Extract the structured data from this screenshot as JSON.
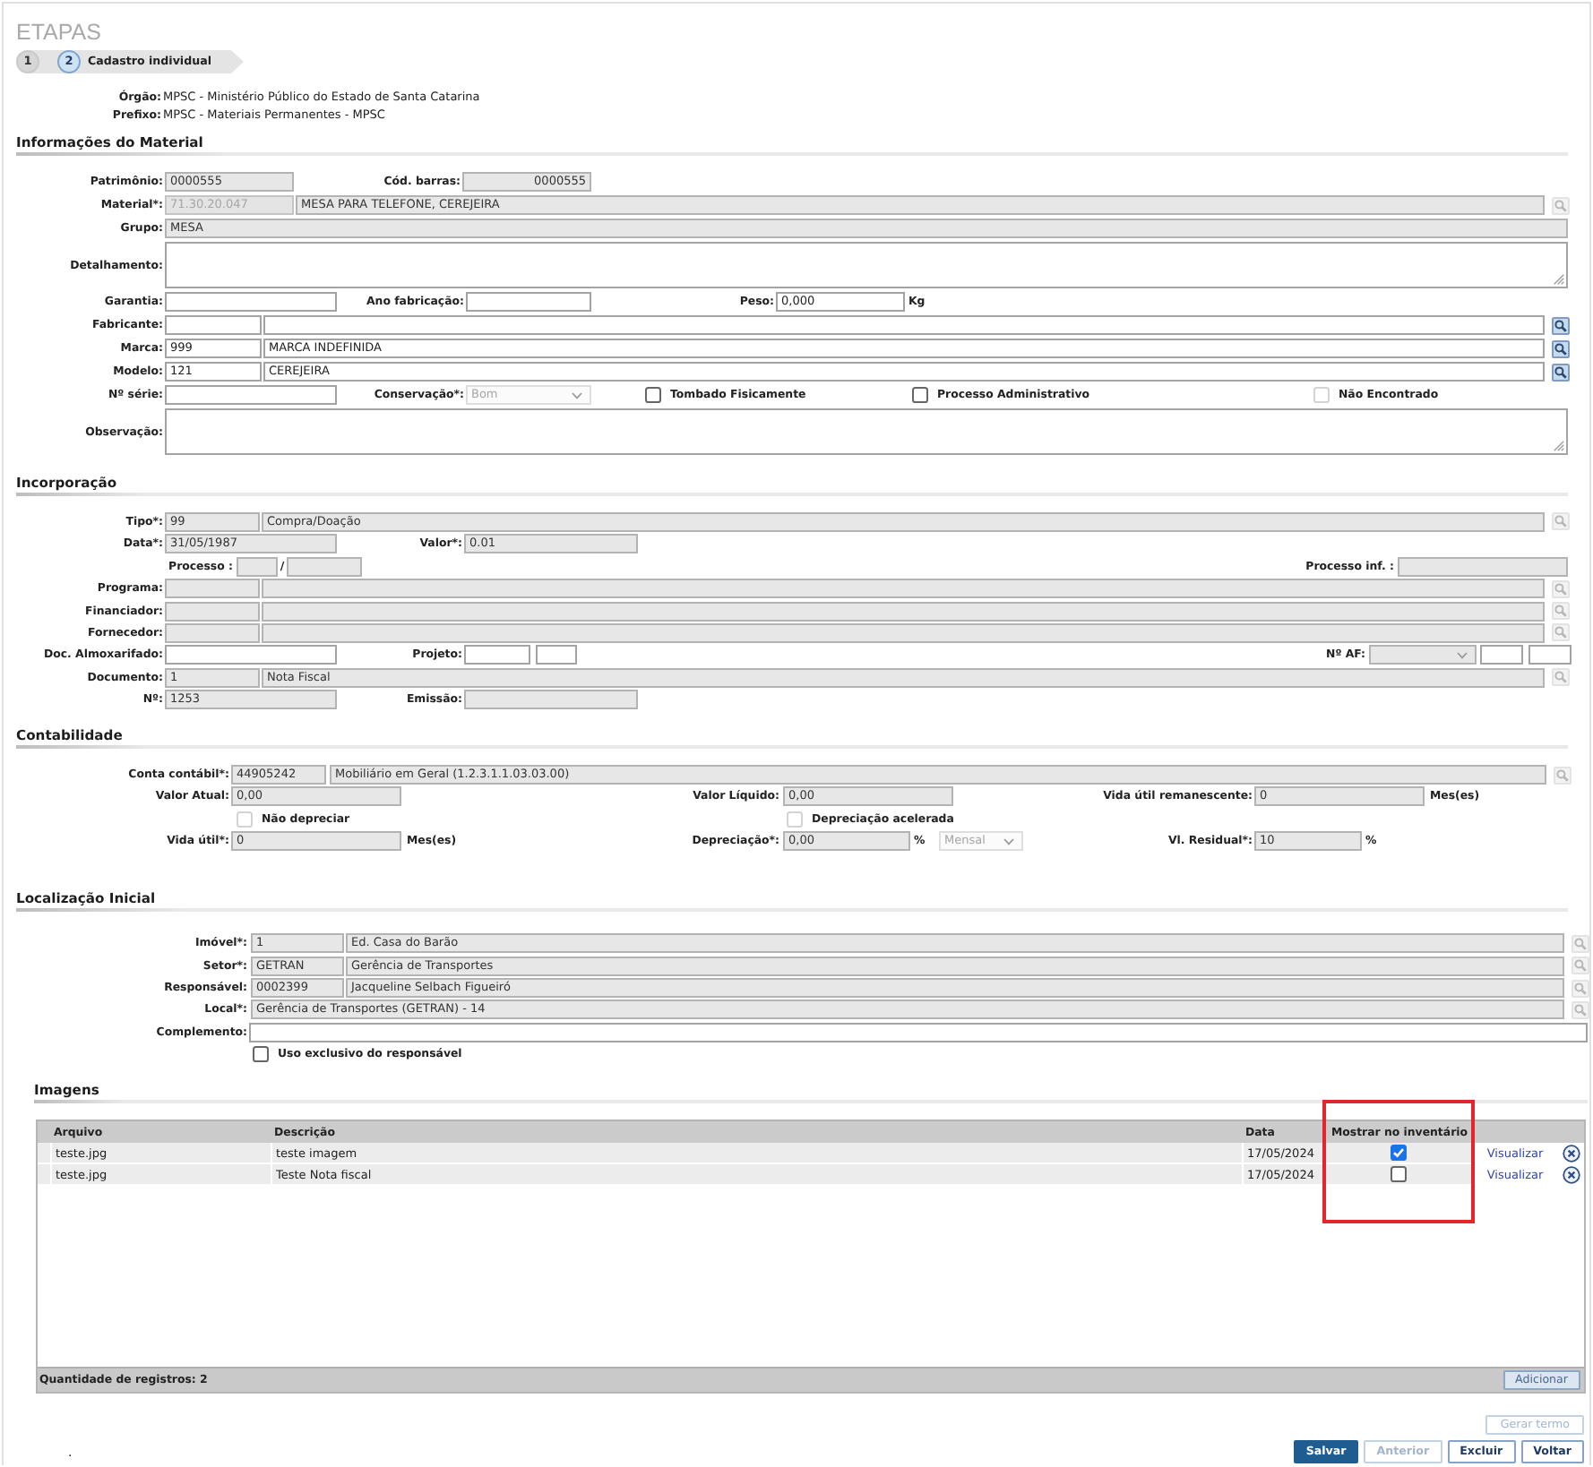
{
  "steps_heading": "ETAPAS",
  "steps": [
    {
      "number": "1",
      "selected": false
    },
    {
      "number": "2",
      "label": "Cadastro individual",
      "selected": true
    }
  ],
  "header_info": [
    {
      "label": "Órgão:",
      "value": "MPSC - Ministério Público do Estado de Santa Catarina"
    },
    {
      "label": "Prefixo:",
      "value": "MPSC - Materiais Permanentes - MPSC"
    }
  ],
  "sections": [
    {
      "title": "Informações do Material",
      "fields": [
        {
          "label": "Patrimônio:",
          "controls": [
            {
              "kind": "input",
              "value": "0000555",
              "readonly": true,
              "disabled": false
            }
          ]
        },
        {
          "label": "Cód. barras:",
          "controls": [
            {
              "kind": "input",
              "value": "0000555",
              "readonly": true,
              "disabled": false
            }
          ]
        },
        {
          "label": "Material*:",
          "controls": [
            {
              "kind": "input",
              "value": "71.30.20.047",
              "readonly": true,
              "disabled": true
            },
            {
              "kind": "input",
              "value": "MESA PARA TELEFONE, CEREJEIRA",
              "readonly": true,
              "disabled": false
            },
            {
              "kind": "lookup",
              "disabled": true
            }
          ]
        },
        {
          "label": "Grupo:",
          "controls": [
            {
              "kind": "input",
              "value": "MESA",
              "readonly": true,
              "disabled": false
            }
          ]
        },
        {
          "label": "Detalhamento:",
          "controls": [
            {
              "kind": "textarea",
              "readonly": false,
              "disabled": false
            }
          ]
        },
        {
          "label": "Garantia:",
          "controls": [
            {
              "kind": "input",
              "readonly": false,
              "disabled": false
            }
          ]
        },
        {
          "label": "Ano fabricação:",
          "controls": [
            {
              "kind": "input",
              "readonly": false,
              "disabled": false
            }
          ]
        },
        {
          "label": "Peso:",
          "controls": [
            {
              "kind": "input",
              "value": "0,000",
              "readonly": false,
              "disabled": false
            },
            {
              "kind": "unit",
              "text": "Kg"
            }
          ]
        },
        {
          "label": "Fabricante:",
          "controls": [
            {
              "kind": "input",
              "readonly": false,
              "disabled": false
            },
            {
              "kind": "input",
              "readonly": false,
              "disabled": false
            },
            {
              "kind": "lookup",
              "disabled": false
            }
          ]
        },
        {
          "label": "Marca:",
          "controls": [
            {
              "kind": "input",
              "value": "999",
              "readonly": false,
              "disabled": false
            },
            {
              "kind": "input",
              "value": "MARCA INDEFINIDA",
              "readonly": false,
              "disabled": false
            },
            {
              "kind": "lookup",
              "disabled": false
            }
          ]
        },
        {
          "label": "Modelo:",
          "controls": [
            {
              "kind": "input",
              "value": "121",
              "readonly": false,
              "disabled": false
            },
            {
              "kind": "input",
              "value": "CEREJEIRA",
              "readonly": false,
              "disabled": false
            },
            {
              "kind": "lookup",
              "disabled": false
            }
          ]
        },
        {
          "label": "Nº série:",
          "controls": [
            {
              "kind": "input",
              "readonly": false,
              "disabled": false
            }
          ]
        },
        {
          "label": "Conservação*:",
          "controls": [
            {
              "kind": "select",
              "value": "Bom",
              "readonly": false,
              "disabled": true
            }
          ]
        },
        {
          "controls": [
            {
              "kind": "checkbox",
              "label": "Tombado Fisicamente",
              "checked": false,
              "disabled": false
            }
          ]
        },
        {
          "controls": [
            {
              "kind": "checkbox",
              "label": "Processo Administrativo",
              "checked": false,
              "disabled": false
            }
          ]
        },
        {
          "controls": [
            {
              "kind": "checkbox",
              "label": "Não Encontrado",
              "checked": false,
              "disabled": true
            }
          ]
        },
        {
          "label": "Observação:",
          "controls": [
            {
              "kind": "textarea",
              "readonly": false,
              "disabled": false
            }
          ]
        }
      ]
    },
    {
      "title": "Incorporação",
      "fields": [
        {
          "label": "Tipo*:",
          "controls": [
            {
              "kind": "input",
              "value": "99",
              "readonly": true,
              "disabled": false
            },
            {
              "kind": "input",
              "value": "Compra/Doação",
              "readonly": true,
              "disabled": false
            },
            {
              "kind": "lookup",
              "disabled": true
            }
          ]
        },
        {
          "label": "Data*:",
          "controls": [
            {
              "kind": "input",
              "value": "31/05/1987",
              "readonly": true,
              "disabled": false
            }
          ]
        },
        {
          "label": "Valor*:",
          "controls": [
            {
              "kind": "input",
              "value": "0.01",
              "readonly": true,
              "disabled": false
            }
          ]
        },
        {
          "label": "Processo :",
          "controls": [
            {
              "kind": "input",
              "readonly": true,
              "disabled": false
            },
            {
              "kind": "unit",
              "text": "/"
            },
            {
              "kind": "input",
              "readonly": true,
              "disabled": false
            }
          ]
        },
        {
          "label": "Processo inf. :",
          "controls": [
            {
              "kind": "input",
              "readonly": true,
              "disabled": false
            }
          ]
        },
        {
          "label": "Programa:",
          "controls": [
            {
              "kind": "input",
              "readonly": true,
              "disabled": false
            },
            {
              "kind": "input",
              "readonly": true,
              "disabled": false
            },
            {
              "kind": "lookup",
              "disabled": true
            }
          ]
        },
        {
          "label": "Financiador:",
          "controls": [
            {
              "kind": "input",
              "readonly": true,
              "disabled": false
            },
            {
              "kind": "input",
              "readonly": true,
              "disabled": false
            },
            {
              "kind": "lookup",
              "disabled": true
            }
          ]
        },
        {
          "label": "Fornecedor:",
          "controls": [
            {
              "kind": "input",
              "readonly": true,
              "disabled": false
            },
            {
              "kind": "input",
              "readonly": true,
              "disabled": false
            },
            {
              "kind": "lookup",
              "disabled": true
            }
          ]
        },
        {
          "label": "Doc. Almoxarifado:",
          "controls": [
            {
              "kind": "input",
              "readonly": false,
              "disabled": false
            }
          ]
        },
        {
          "label": "Projeto:",
          "controls": [
            {
              "kind": "input",
              "readonly": false,
              "disabled": false
            },
            {
              "kind": "input",
              "readonly": false,
              "disabled": false
            }
          ]
        },
        {
          "label": "Nº AF:",
          "controls": [
            {
              "kind": "select",
              "readonly": true,
              "disabled": false
            },
            {
              "kind": "input",
              "readonly": false,
              "disabled": false
            },
            {
              "kind": "input",
              "readonly": false,
              "disabled": false
            }
          ]
        },
        {
          "label": "Documento:",
          "controls": [
            {
              "kind": "input",
              "value": "1",
              "readonly": true,
              "disabled": false
            },
            {
              "kind": "input",
              "value": "Nota Fiscal",
              "readonly": true,
              "disabled": false
            },
            {
              "kind": "lookup",
              "disabled": true
            }
          ]
        },
        {
          "label": "Nº:",
          "controls": [
            {
              "kind": "input",
              "value": "1253",
              "readonly": true,
              "disabled": false
            }
          ]
        },
        {
          "label": "Emissão:",
          "controls": [
            {
              "kind": "input",
              "readonly": true,
              "disabled": false
            }
          ]
        }
      ]
    },
    {
      "title": "Contabilidade",
      "fields": [
        {
          "label": "Conta contábil*:",
          "controls": [
            {
              "kind": "input",
              "value": "44905242",
              "readonly": true,
              "disabled": false
            },
            {
              "kind": "input",
              "value": "Mobiliário em Geral (1.2.3.1.1.03.03.00)",
              "readonly": true,
              "disabled": false
            },
            {
              "kind": "lookup",
              "disabled": true
            }
          ]
        },
        {
          "label": "Valor Atual:",
          "controls": [
            {
              "kind": "input",
              "value": "0,00",
              "readonly": true,
              "disabled": false
            }
          ]
        },
        {
          "label": "Valor Líquido:",
          "controls": [
            {
              "kind": "input",
              "value": "0,00",
              "readonly": true,
              "disabled": false
            }
          ]
        },
        {
          "label": "Vida útil remanescente:",
          "controls": [
            {
              "kind": "input",
              "value": "0",
              "readonly": true,
              "disabled": false
            },
            {
              "kind": "unit",
              "text": "Mes(es)"
            }
          ]
        },
        {
          "controls": [
            {
              "kind": "checkbox",
              "label": "Não depreciar",
              "checked": false,
              "disabled": true
            }
          ]
        },
        {
          "controls": [
            {
              "kind": "checkbox",
              "label": "Depreciação acelerada",
              "checked": false,
              "disabled": true
            }
          ]
        },
        {
          "label": "Vida útil*:",
          "controls": [
            {
              "kind": "input",
              "value": "0",
              "readonly": true,
              "disabled": false
            },
            {
              "kind": "unit",
              "text": "Mes(es)"
            }
          ]
        },
        {
          "label": "Depreciação*:",
          "controls": [
            {
              "kind": "input",
              "value": "0,00",
              "readonly": true,
              "disabled": false
            },
            {
              "kind": "unit",
              "text": "%"
            },
            {
              "kind": "select",
              "value": "Mensal",
              "readonly": false,
              "disabled": true
            }
          ]
        },
        {
          "label": "Vl. Residual*:",
          "controls": [
            {
              "kind": "input",
              "value": "10",
              "readonly": true,
              "disabled": false
            },
            {
              "kind": "unit",
              "text": "%"
            }
          ]
        }
      ]
    },
    {
      "title": "Localização Inicial",
      "fields": [
        {
          "label": "Imóvel*:",
          "controls": [
            {
              "kind": "input",
              "value": "1",
              "readonly": true,
              "disabled": false
            },
            {
              "kind": "input",
              "value": "Ed. Casa do Barão",
              "readonly": true,
              "disabled": false
            },
            {
              "kind": "lookup",
              "disabled": true
            }
          ]
        },
        {
          "label": "Setor*:",
          "controls": [
            {
              "kind": "input",
              "value": "GETRAN",
              "readonly": true,
              "disabled": false
            },
            {
              "kind": "input",
              "value": "Gerência de Transportes",
              "readonly": true,
              "disabled": false
            },
            {
              "kind": "lookup",
              "disabled": true
            }
          ]
        },
        {
          "label": "Responsável:",
          "controls": [
            {
              "kind": "input",
              "value": "0002399",
              "readonly": true,
              "disabled": false
            },
            {
              "kind": "input",
              "value": "Jacqueline Selbach Figueiró",
              "readonly": true,
              "disabled": false
            },
            {
              "kind": "lookup",
              "disabled": true
            }
          ]
        },
        {
          "label": "Local*:",
          "controls": [
            {
              "kind": "input",
              "value": "Gerência de Transportes (GETRAN) - 14",
              "readonly": true,
              "disabled": false
            },
            {
              "kind": "lookup",
              "disabled": true
            }
          ]
        },
        {
          "label": "Complemento:",
          "controls": [
            {
              "kind": "input",
              "readonly": false,
              "disabled": false
            }
          ]
        },
        {
          "controls": [
            {
              "kind": "checkbox",
              "label": "Uso exclusivo do responsável",
              "checked": false,
              "disabled": false
            }
          ]
        }
      ]
    }
  ],
  "images": {
    "title": "Imagens",
    "columns": [
      {
        "label": "Arquivo",
        "highlighted": false
      },
      {
        "label": "Descrição",
        "highlighted": false
      },
      {
        "label": "Data",
        "highlighted": false
      },
      {
        "label": "Mostrar no inventário",
        "highlighted": true
      }
    ],
    "rows": [
      {
        "file": "teste.jpg",
        "description": "teste imagem",
        "date": "17/05/2024",
        "show_in_inventory": true,
        "link": "Visualizar"
      },
      {
        "file": "teste.jpg",
        "description": "Teste Nota fiscal",
        "date": "17/05/2024",
        "show_in_inventory": false,
        "link": "Visualizar"
      }
    ],
    "record_count": "Quantidade de registros: 2",
    "add_button": "Adicionar"
  },
  "term_button": {
    "label": "Gerar termo",
    "disabled": true
  },
  "footnote": ".",
  "actions": [
    {
      "label": "Salvar",
      "kind": "primary",
      "disabled": false
    },
    {
      "label": "Anterior",
      "kind": "default",
      "disabled": true
    },
    {
      "label": "Excluir",
      "kind": "default",
      "disabled": false
    },
    {
      "label": "Voltar",
      "kind": "default",
      "disabled": false
    }
  ]
}
